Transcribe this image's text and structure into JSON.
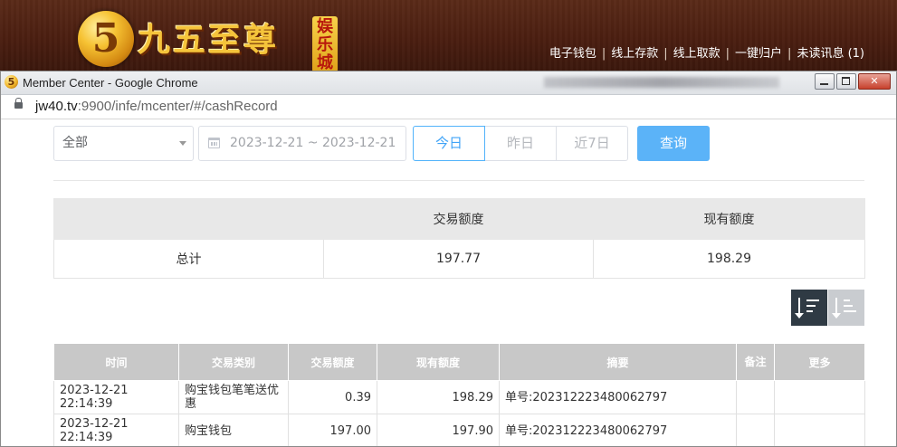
{
  "site": {
    "logo_char": "5",
    "logo_title": "九五至尊",
    "logo_badge": "娱乐城",
    "nav": [
      "电子钱包",
      "线上存款",
      "线上取款",
      "一键归户",
      "未读讯息 (1)"
    ]
  },
  "window": {
    "title": "Member Center - Google Chrome",
    "url_host": "jw40.tv",
    "url_rest": ":9900/infe/mcenter/#/cashRecord"
  },
  "filters": {
    "type_value": "全部",
    "date_range": "2023-12-21 ~ 2023-12-21",
    "quick": [
      "今日",
      "昨日",
      "近7日"
    ],
    "quick_active": "今日",
    "search_label": "查询"
  },
  "summary": {
    "headers": [
      "",
      "交易额度",
      "现有额度"
    ],
    "row": [
      "总计",
      "197.77",
      "198.29"
    ]
  },
  "records": {
    "headers": [
      "时间",
      "交易类别",
      "交易额度",
      "现有额度",
      "摘要",
      "备注",
      "更多"
    ],
    "rows": [
      [
        "2023-12-21 22:14:39",
        "购宝钱包笔笔送优惠",
        "0.39",
        "198.29",
        "单号:202312223480062797",
        "",
        ""
      ],
      [
        "2023-12-21 22:14:39",
        "购宝钱包",
        "197.00",
        "197.90",
        "单号:202312223480062797",
        "",
        ""
      ]
    ]
  },
  "colors": {
    "header_bg": "#4a1e10",
    "logo_gold": "#f5c43b",
    "accent_blue": "#5bb3f8",
    "sort_active": "#2f3a44",
    "table_head": "#c8c8c8"
  }
}
